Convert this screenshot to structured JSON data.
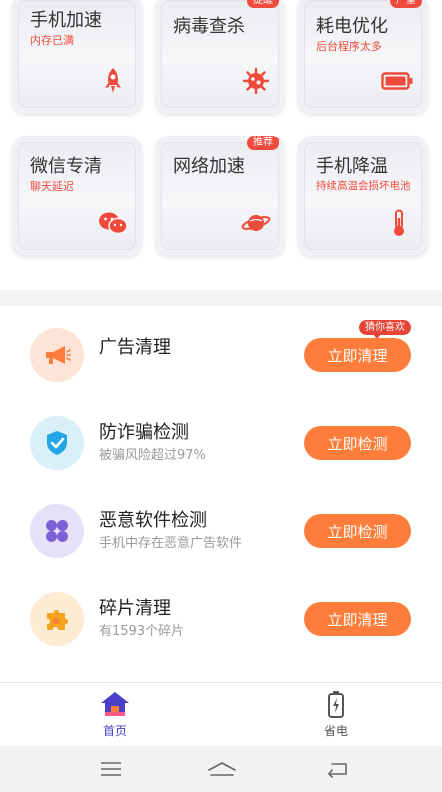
{
  "tiles": [
    {
      "title": "手机加速",
      "subtitle": "内存已满",
      "icon": "rocket-icon",
      "badge": ""
    },
    {
      "title": "病毒查杀",
      "subtitle": "",
      "icon": "virus-icon",
      "badge": "提醒"
    },
    {
      "title": "耗电优化",
      "subtitle": "后台程序太多",
      "icon": "battery-icon",
      "badge": "严重"
    },
    {
      "title": "微信专清",
      "subtitle": "聊天延迟",
      "icon": "wechat-icon",
      "badge": ""
    },
    {
      "title": "网络加速",
      "subtitle": "",
      "icon": "planet-icon",
      "badge": "推荐"
    },
    {
      "title": "手机降温",
      "subtitle": "持续高温会损坏电池",
      "icon": "thermometer-icon",
      "badge": ""
    }
  ],
  "list": [
    {
      "title": "广告清理",
      "subtitle": "",
      "button": "立即清理",
      "tag": "猜你喜欢",
      "icon": "megaphone-icon",
      "icon_bg": "#fde4d6"
    },
    {
      "title": "防诈骗检测",
      "subtitle": "被骗风险超过97%",
      "button": "立即检测",
      "tag": "",
      "icon": "shield-icon",
      "icon_bg": "#d9f0fb"
    },
    {
      "title": "恶意软件检测",
      "subtitle": "手机中存在恶意广告软件",
      "button": "立即检测",
      "tag": "",
      "icon": "apps-icon",
      "icon_bg": "#e7e1f8"
    },
    {
      "title": "碎片清理",
      "subtitle": "有1593个碎片",
      "button": "立即清理",
      "tag": "",
      "icon": "puzzle-icon",
      "icon_bg": "#fdebd3"
    }
  ],
  "bottom_nav": [
    {
      "label": "首页",
      "icon": "home-icon",
      "active": true
    },
    {
      "label": "省电",
      "icon": "battery-charge-icon",
      "active": false
    }
  ],
  "colors": {
    "accent": "#ff7d3a",
    "alert": "#ef4a3c",
    "active_nav": "#4a3fc9",
    "inactive_nav": "#555555"
  },
  "system_bar": [
    "menu-icon",
    "home-outline-icon",
    "back-icon"
  ]
}
